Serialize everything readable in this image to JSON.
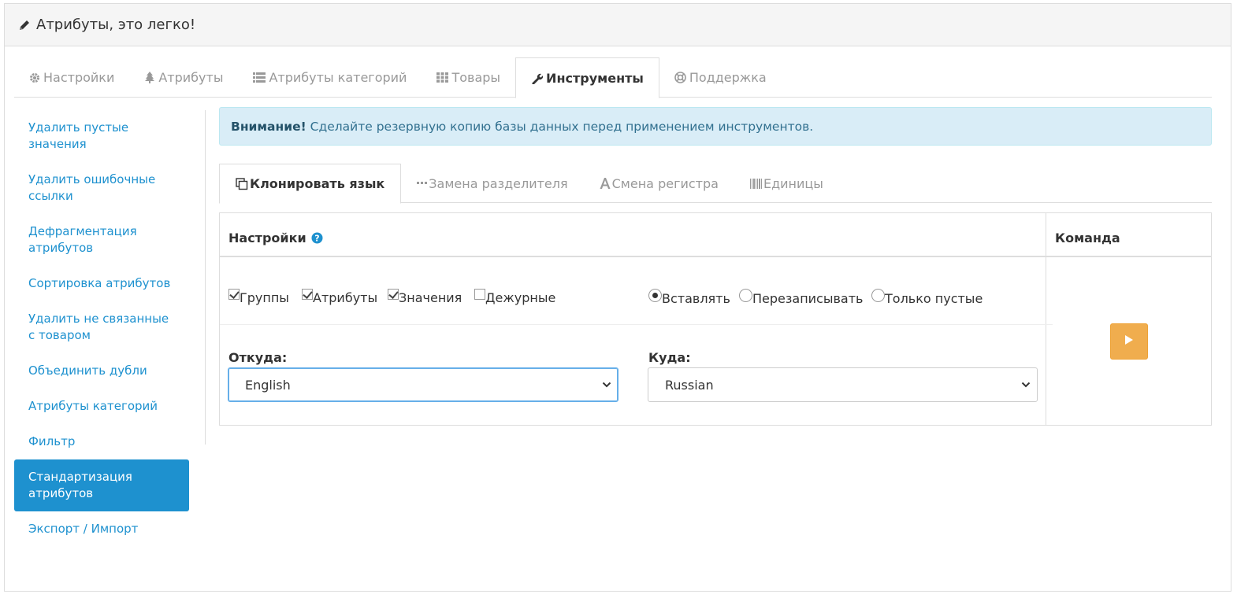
{
  "panel": {
    "title": "Атрибуты, это легко!"
  },
  "main_tabs": [
    {
      "label": "Настройки",
      "icon": "gear-icon"
    },
    {
      "label": "Атрибуты",
      "icon": "tree-icon"
    },
    {
      "label": "Атрибуты категорий",
      "icon": "list-icon"
    },
    {
      "label": "Товары",
      "icon": "grid-icon"
    },
    {
      "label": "Инструменты",
      "icon": "wrench-icon",
      "active": true
    },
    {
      "label": "Поддержка",
      "icon": "lifebuoy-icon"
    }
  ],
  "sidebar": {
    "items": [
      {
        "label": "Удалить пустые значения"
      },
      {
        "label": "Удалить ошибочные ссылки"
      },
      {
        "label": "Дефрагментация атрибутов"
      },
      {
        "label": "Сортировка атрибутов"
      },
      {
        "label": "Удалить не связанные с товаром"
      },
      {
        "label": "Объединить дубли"
      },
      {
        "label": "Атрибуты категорий"
      },
      {
        "label": "Фильтр"
      },
      {
        "label": "Стандартизация атрибутов",
        "active": true
      },
      {
        "label": "Экспорт / Импорт"
      }
    ]
  },
  "alert": {
    "strong": "Внимание!",
    "text": "Сделайте резервную копию базы данных перед применением инструментов."
  },
  "sub_tabs": [
    {
      "label": "Клонировать язык",
      "icon": "clone-icon",
      "active": true
    },
    {
      "label": "Замена разделителя",
      "icon": "dots-icon"
    },
    {
      "label": "Смена регистра",
      "icon": "font-icon"
    },
    {
      "label": "Единицы",
      "icon": "barcode-icon"
    }
  ],
  "table": {
    "settings_header": "Настройки",
    "command_header": "Команда",
    "checkboxes": [
      {
        "label": "Группы",
        "checked": true
      },
      {
        "label": "Атрибуты",
        "checked": true
      },
      {
        "label": "Значения",
        "checked": true
      },
      {
        "label": "Дежурные",
        "checked": false
      }
    ],
    "radios": [
      {
        "label": "Вставлять",
        "checked": true
      },
      {
        "label": "Перезаписывать",
        "checked": false
      },
      {
        "label": "Только пустые",
        "checked": false
      }
    ],
    "from": {
      "label": "Откуда:",
      "value": "English"
    },
    "to": {
      "label": "Куда:",
      "value": "Russian"
    }
  },
  "colors": {
    "link": "#1e91cf",
    "alert_bg": "#d9edf7",
    "run_button": "#f0ad4e"
  }
}
